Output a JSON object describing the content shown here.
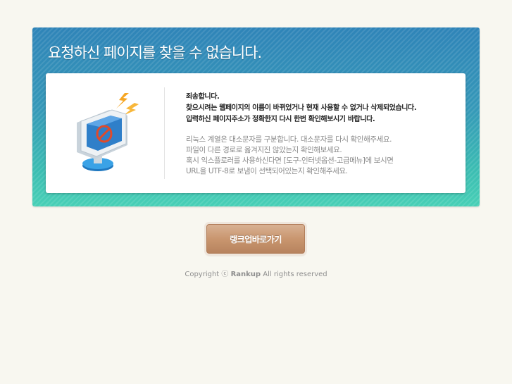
{
  "panel": {
    "title": "요청하신 페이지를 찾을 수 없습니다."
  },
  "message": {
    "sorry": "죄송합니다.",
    "line1": "찾으시려는 웹페이지의 이름이 바뀌었거나 현재 사용할 수 없거나 삭제되었습니다.",
    "line2": "입력하신 페이지주소가 정확한지 다시 한번 확인해보시기 바랍니다.",
    "tips": [
      "리눅스 계열은 대소문자를 구분합니다. 대소문자를 다시 확인해주세요.",
      "파일이 다른 경로로 옮겨지진 않았는지 확인해보세요.",
      "혹시 익스플로러를 사용하신다면 [도구-인터넷옵션-고급메뉴]에 보시면",
      "URL을 UTF-8로 보냄이 선택되어있는지 확인해주세요."
    ]
  },
  "button": {
    "label": "랭크업바로가기"
  },
  "footer": {
    "prefix": "Copyright ",
    "symbol": "ⓒ",
    "brand": "Rankup",
    "suffix": " All rights reserved"
  },
  "illustration": {
    "icon": "error-monitor-icon",
    "colors": {
      "monitor_body": "#e9eef2",
      "screen": "#2f7fc9",
      "base": "#2d8fd6",
      "prohibit": "#e04a2a",
      "lightning": "#f6a623"
    }
  }
}
